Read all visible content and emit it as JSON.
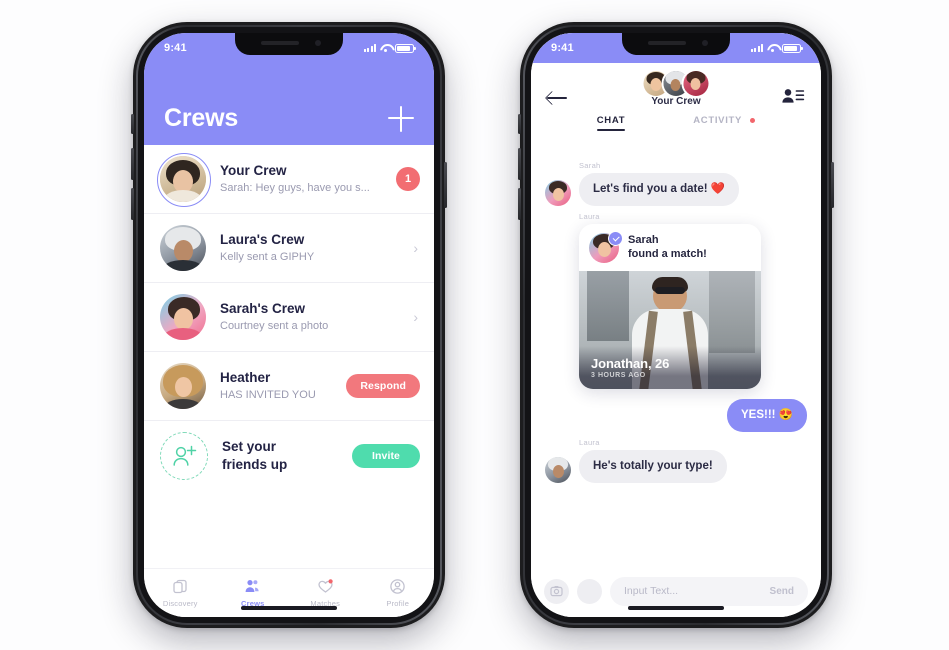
{
  "statusbar": {
    "time": "9:41"
  },
  "left_phone": {
    "header": {
      "title": "Crews",
      "add_icon": "plus-icon"
    },
    "crews": [
      {
        "name": "Your Crew",
        "sub": "Sarah: Hey guys, have you s...",
        "right": "badge",
        "badge": "1",
        "ringed": true
      },
      {
        "name": "Laura's Crew",
        "sub": "Kelly sent a GIPHY",
        "right": "chevron",
        "chevron": "›",
        "ringed": false
      },
      {
        "name": "Sarah's Crew",
        "sub": "Courtney sent a photo",
        "right": "chevron",
        "chevron": "›",
        "ringed": false
      },
      {
        "name": "Heather",
        "sub": "HAS INVITED YOU",
        "right": "respond",
        "action": "Respond",
        "ringed": false
      }
    ],
    "invite_row": {
      "line1": "Set your",
      "line2": "friends up",
      "action": "Invite",
      "icon": "add-person-icon"
    },
    "tabbar": [
      {
        "label": "Discovery",
        "icon": "cards-icon",
        "active": false,
        "dot": false
      },
      {
        "label": "Crews",
        "icon": "people-icon",
        "active": true,
        "dot": false
      },
      {
        "label": "Matches",
        "icon": "heart-icon",
        "active": false,
        "dot": true
      },
      {
        "label": "Profile",
        "icon": "person-icon",
        "active": false,
        "dot": false
      }
    ]
  },
  "right_phone": {
    "header": {
      "back_icon": "back-arrow-icon",
      "members_icon": "people-list-icon",
      "crew_title": "Your Crew",
      "tabs": [
        {
          "label": "CHAT",
          "active": true,
          "dot": false
        },
        {
          "label": "ACTIVITY",
          "active": false,
          "dot": true
        }
      ]
    },
    "messages": [
      {
        "kind": "text",
        "sender": "Sarah",
        "text": "Let's find you a date! ❤️",
        "side": "in"
      },
      {
        "kind": "card",
        "sender": "Laura",
        "card": {
          "author": "Sarah",
          "action": "found a match!",
          "verified": true,
          "match_name": "Jonathan, 26",
          "match_time": "3 HOURS AGO"
        }
      },
      {
        "kind": "text",
        "sender": "",
        "text": "YES!!! 😍",
        "side": "out"
      },
      {
        "kind": "text",
        "sender": "Laura",
        "text": "He's totally your type!",
        "side": "in"
      }
    ],
    "input": {
      "placeholder": "Input Text...",
      "send_label": "Send",
      "camera_icon": "camera-icon",
      "extra_icon": "circle-icon"
    }
  },
  "colors": {
    "purple": "#8a8cf6",
    "red": "#f26d72",
    "coral": "#f2787d",
    "green": "#4fdcad",
    "text_dark": "#232344",
    "text_muted": "#9a9ab0"
  }
}
